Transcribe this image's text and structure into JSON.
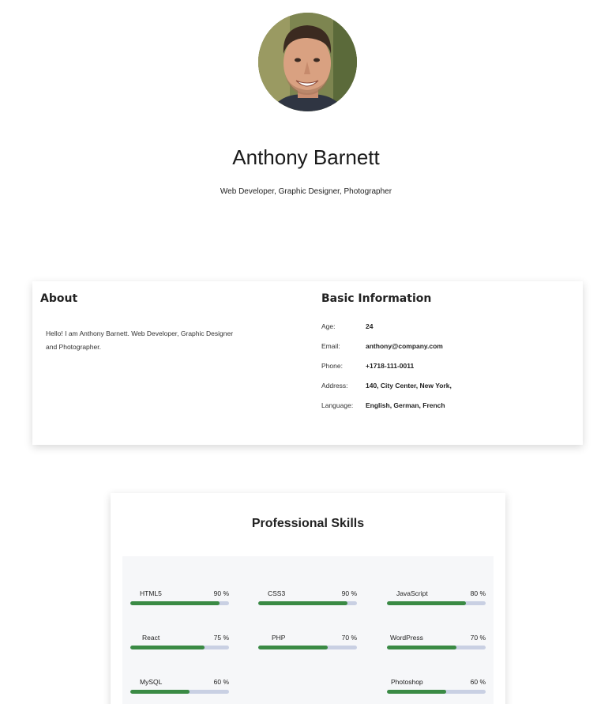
{
  "profile": {
    "avatar_icon": "person-photo",
    "name": "Anthony Barnett",
    "tagline": "Web Developer, Graphic Designer,  Photographer"
  },
  "about": {
    "title": "About",
    "text": "Hello! I am Anthony Barnett. Web Developer, Graphic Designer and Photographer."
  },
  "basic_info": {
    "title": "Basic Information",
    "rows": [
      {
        "key": "Age:",
        "value": "24"
      },
      {
        "key": "Email:",
        "value": "anthony@company.com"
      },
      {
        "key": "Phone:",
        "value": "+1718-111-0011"
      },
      {
        "key": "Address:",
        "value": "140, City Center, New York,"
      },
      {
        "key": "Language:",
        "value": "English, German, French"
      }
    ]
  },
  "skills": {
    "title": "Professional Skills",
    "fill_color": "#3a8a44",
    "track_color": "#c9d0e3",
    "items": [
      {
        "name": "HTML5",
        "percent_label": "90 %",
        "level": 0.9
      },
      {
        "name": "CSS3",
        "percent_label": "90 %",
        "level": 0.9
      },
      {
        "name": "JavaScript",
        "percent_label": "80 %",
        "level": 0.8
      },
      {
        "name": "React",
        "percent_label": "75 %",
        "level": 0.75
      },
      {
        "name": "PHP",
        "percent_label": "70 %",
        "level": 0.7
      },
      {
        "name": "WordPress",
        "percent_label": "70 %",
        "level": 0.7
      },
      {
        "name": "MySQL",
        "percent_label": "60 %",
        "level": 0.6
      },
      {
        "name": "Photoshop",
        "percent_label": "60 %",
        "level": 0.6
      }
    ]
  }
}
